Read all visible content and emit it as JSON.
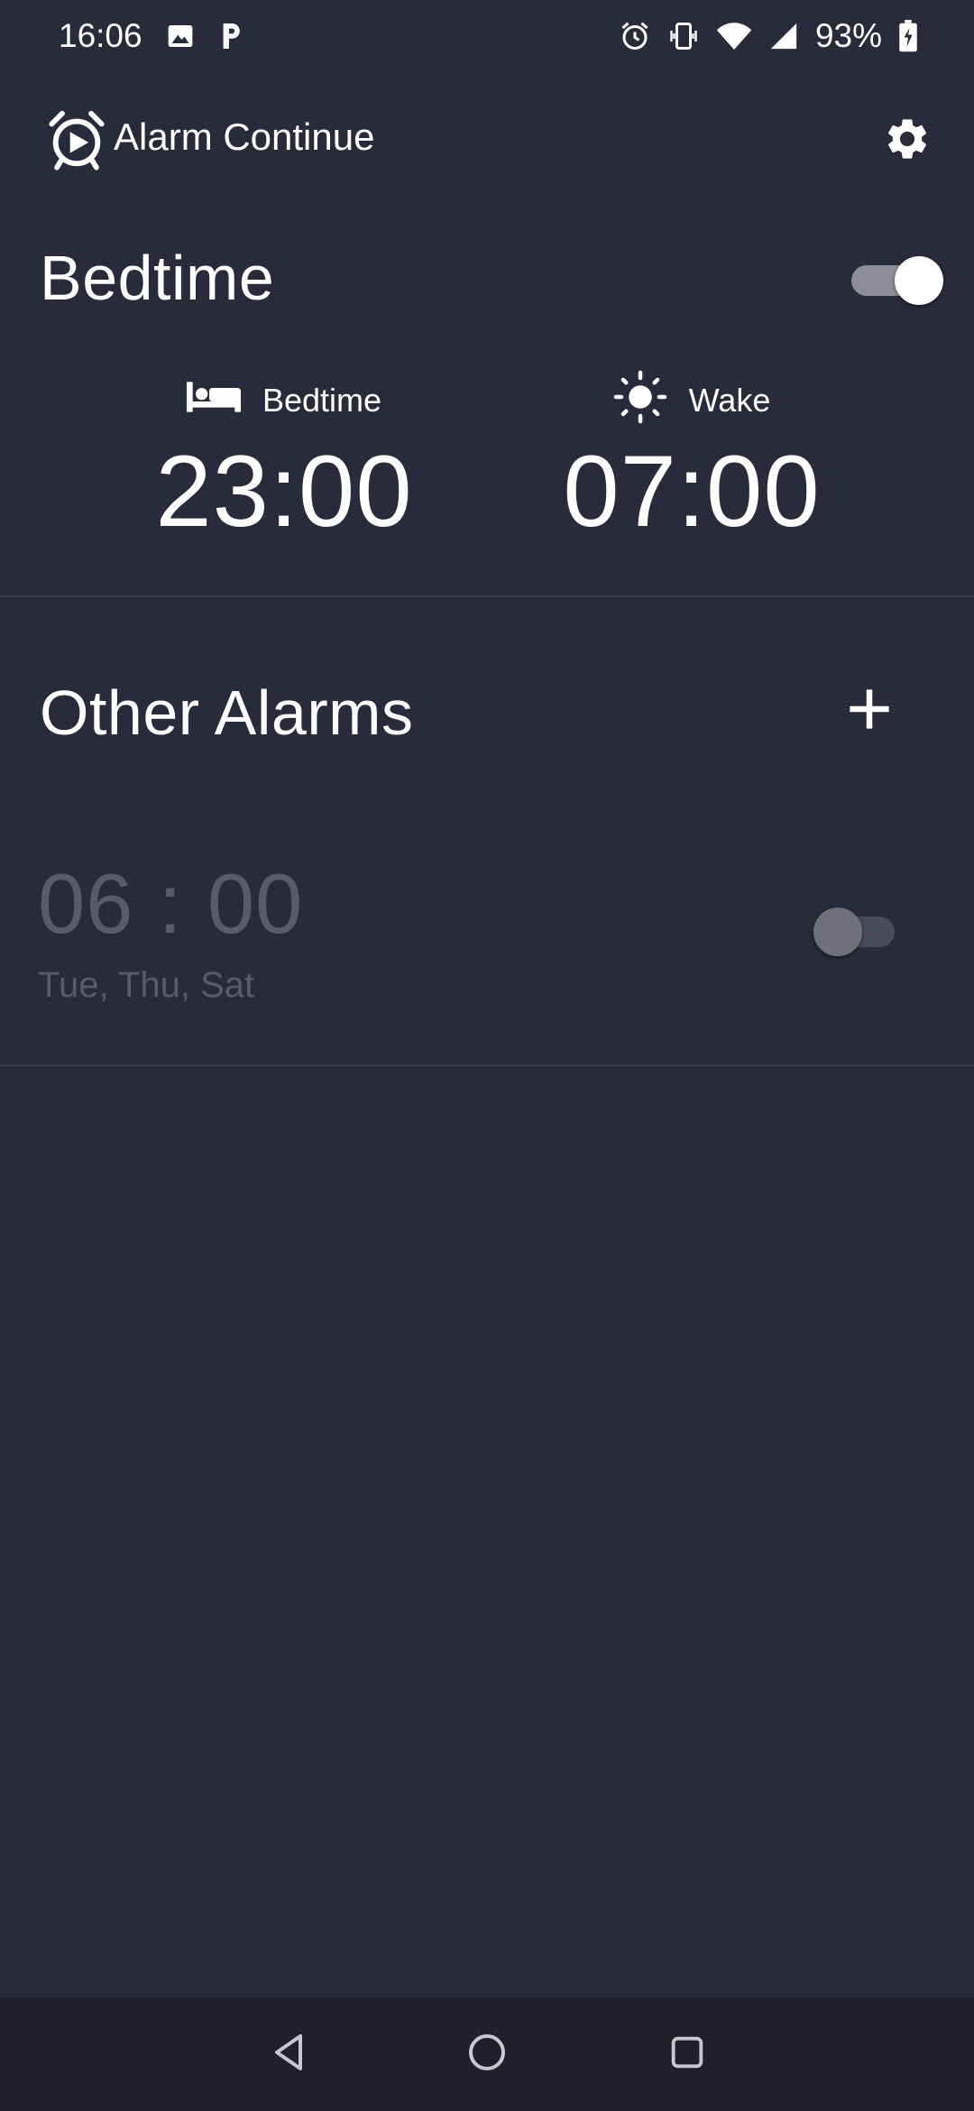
{
  "status_bar": {
    "time": "16:06",
    "battery": "93%",
    "left_icons": [
      "image-icon",
      "parking-icon"
    ],
    "right_icons": [
      "alarm-clock-icon",
      "vibrate-icon",
      "wifi-icon",
      "signal-icon",
      "battery-charging-icon"
    ]
  },
  "app_bar": {
    "title": "Alarm Continue",
    "logo_icon": "alarm-play-icon",
    "settings_icon": "gear-icon"
  },
  "bedtime": {
    "title": "Bedtime",
    "enabled": true,
    "bed_label": "Bedtime",
    "bed_time": "23:00",
    "wake_label": "Wake",
    "wake_time": "07:00"
  },
  "other_alarms": {
    "title": "Other Alarms",
    "add_icon": "plus-icon",
    "items": [
      {
        "time": "06 : 00",
        "days": "Tue, Thu, Sat",
        "enabled": false
      }
    ]
  },
  "nav_bar": {
    "back_icon": "back-triangle-icon",
    "home_icon": "home-circle-icon",
    "recents_icon": "recents-square-icon"
  },
  "colors": {
    "background": "#2a2b3a",
    "nav_background": "#1f2029",
    "text": "#ffffff",
    "disabled_text": "#5a5b68",
    "divider": "#3b3c4b"
  }
}
